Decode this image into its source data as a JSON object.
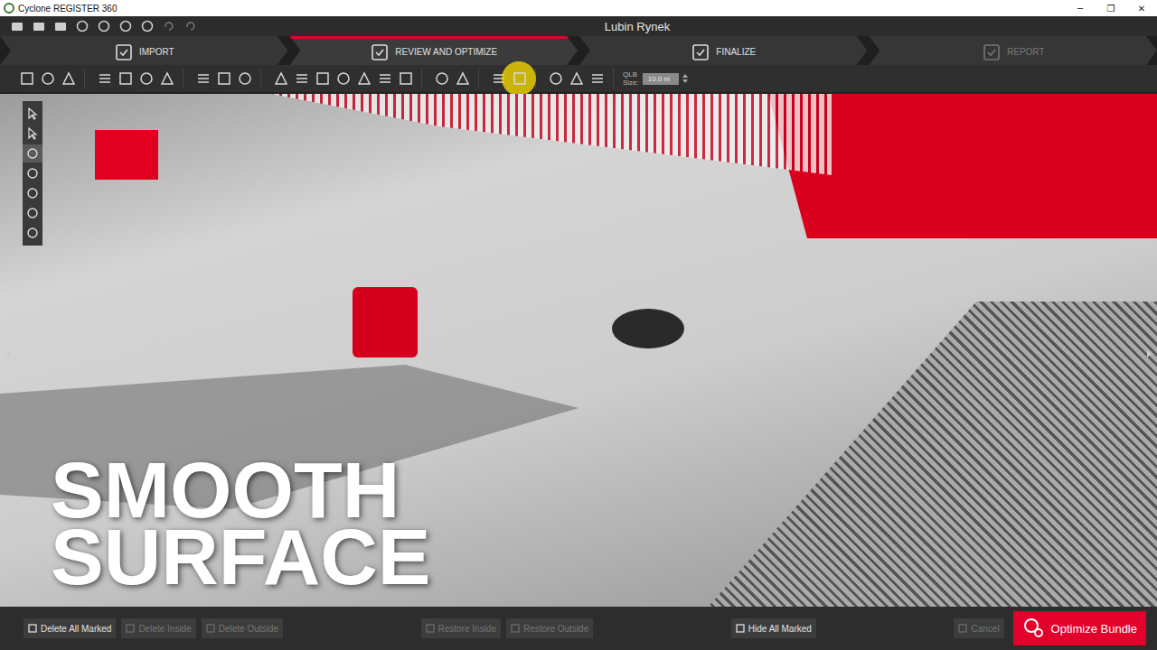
{
  "window": {
    "title": "Cyclone REGISTER 360",
    "controls": [
      "─",
      "❐",
      "✕"
    ]
  },
  "project": {
    "name": "Lubin Rynek"
  },
  "steps": [
    {
      "label": "IMPORT",
      "selected": false,
      "disabled": false
    },
    {
      "label": "REVIEW AND OPTIMIZE",
      "selected": true,
      "disabled": false
    },
    {
      "label": "FINALIZE",
      "selected": false,
      "disabled": false
    },
    {
      "label": "REPORT",
      "selected": false,
      "disabled": true
    }
  ],
  "toolbar": {
    "tools": [
      {
        "highlighted": false
      },
      {
        "highlighted": false
      },
      {
        "highlighted": false
      },
      {
        "highlighted": false
      },
      {
        "highlighted": false
      },
      {
        "highlighted": false
      },
      {
        "highlighted": false
      },
      {
        "highlighted": false
      },
      {
        "highlighted": false
      },
      {
        "highlighted": false
      },
      {
        "highlighted": false
      },
      {
        "highlighted": false
      },
      {
        "highlighted": false
      },
      {
        "highlighted": false
      },
      {
        "highlighted": false
      },
      {
        "highlighted": false
      },
      {
        "highlighted": false
      },
      {
        "highlighted": false
      },
      {
        "highlighted": false
      },
      {
        "highlighted": false
      },
      {
        "highlighted": true
      },
      {
        "highlighted": false
      },
      {
        "highlighted": false
      },
      {
        "highlighted": false
      }
    ],
    "qlb_label": "QLB",
    "size_label": "Size:",
    "size_value": "10.0 m"
  },
  "view_tools": [
    {
      "selected": false
    },
    {
      "selected": false
    },
    {
      "selected": true
    },
    {
      "selected": false
    },
    {
      "selected": false
    },
    {
      "selected": false
    },
    {
      "selected": false
    }
  ],
  "caption": [
    "SMOOTH",
    "SURFACE"
  ],
  "bottom_bar": {
    "groups": [
      {
        "buttons": [
          {
            "label": "Delete All Marked",
            "disabled": false
          },
          {
            "label": "Delete Inside",
            "disabled": true
          },
          {
            "label": "Delete Outside",
            "disabled": true
          }
        ]
      },
      {
        "buttons": [
          {
            "label": "Restore Inside",
            "disabled": true
          },
          {
            "label": "Restore Outside",
            "disabled": true
          }
        ]
      },
      {
        "buttons": [
          {
            "label": "Hide All Marked",
            "disabled": false
          }
        ]
      },
      {
        "buttons": [
          {
            "label": "Cancel",
            "disabled": true
          }
        ]
      }
    ],
    "primary": "Optimize Bundle"
  }
}
